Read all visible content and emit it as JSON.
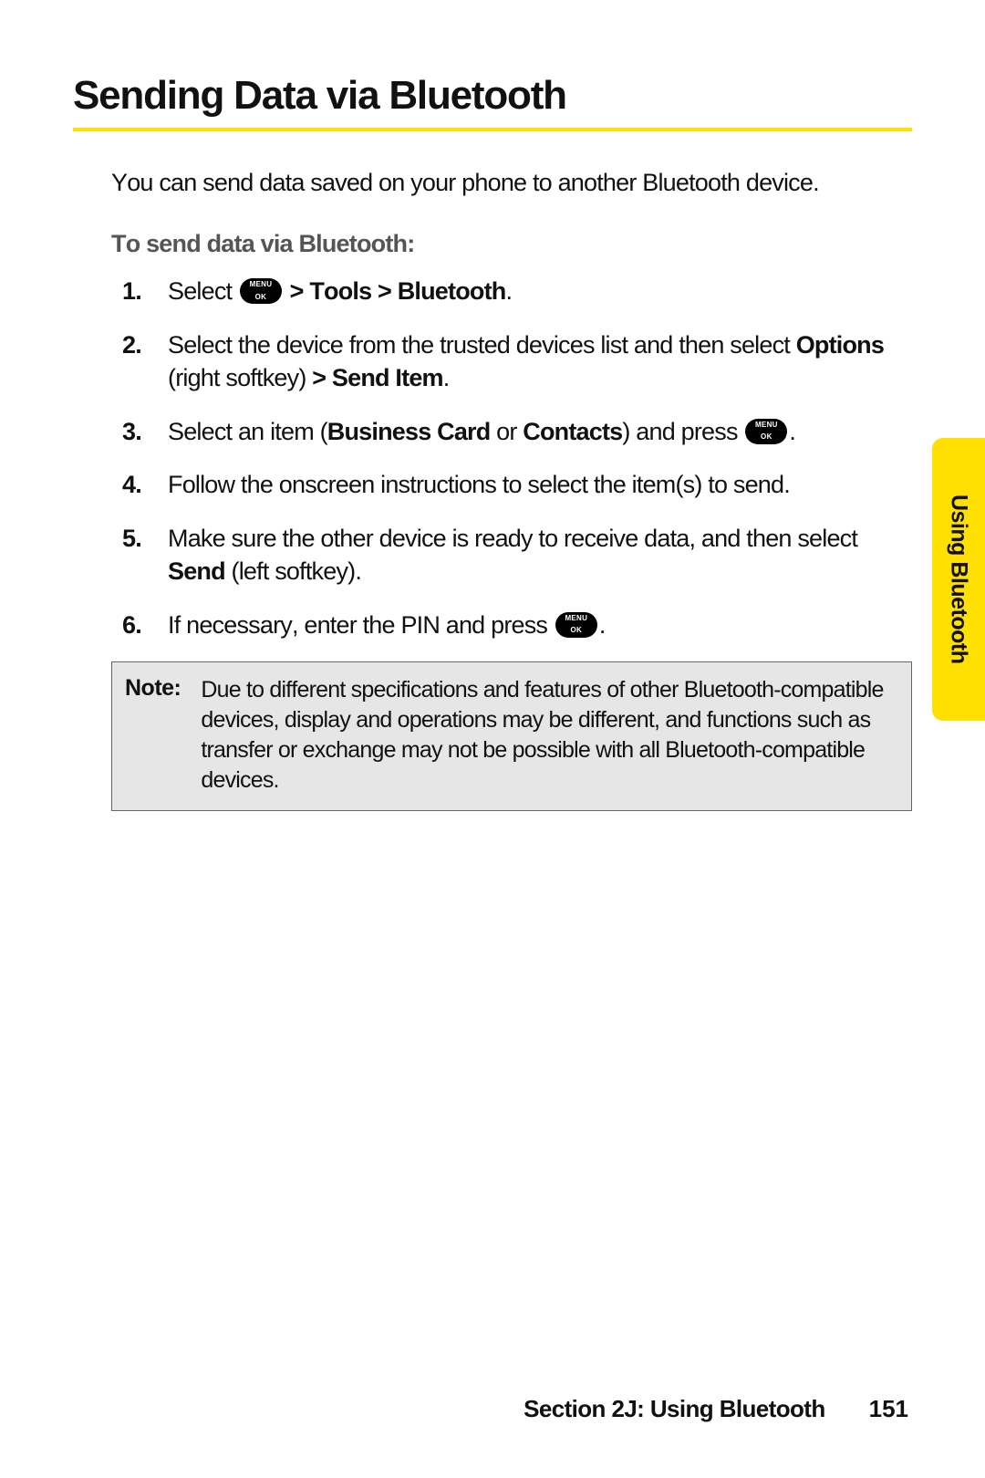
{
  "title": "Sending Data via Bluetooth",
  "intro": "You can send data saved on your phone to another Bluetooth device.",
  "subhead": "To send data via Bluetooth:",
  "icon_label": "MENU/OK",
  "steps": {
    "s1_a": "Select ",
    "s1_b": " > Tools > Bluetooth",
    "s1_c": ".",
    "s2_a": "Select the device from the trusted devices list and then select ",
    "s2_b": "Options",
    "s2_c": " (right softkey) ",
    "s2_d": "> Send Item",
    "s2_e": ".",
    "s3_a": "Select an item (",
    "s3_b": "Business Card",
    "s3_c": " or ",
    "s3_d": "Contacts",
    "s3_e": ") and press ",
    "s3_f": ".",
    "s4": "Follow the onscreen instructions to select the item(s) to send.",
    "s5_a": "Make sure the other device is ready to receive data, and then select ",
    "s5_b": "Send",
    "s5_c": " (left softkey).",
    "s6_a": "If necessary, enter the PIN and press ",
    "s6_b": "."
  },
  "note": {
    "label": "Note:",
    "text": "Due to different specifications and features of other Bluetooth-compatible devices, display and operations may be different, and functions such as transfer or exchange may not be possible with all Bluetooth-compatible devices."
  },
  "side_tab": "Using Bluetooth",
  "footer": {
    "section": "Section 2J: Using Bluetooth",
    "page": "151"
  }
}
